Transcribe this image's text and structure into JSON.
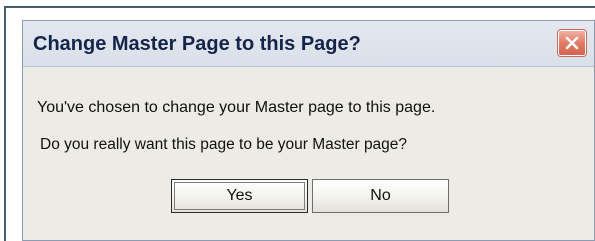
{
  "dialog": {
    "title": "Change Master Page to this Page?",
    "close_icon": "close-icon",
    "message_line1": "You've chosen to change your Master page to this page.",
    "message_line2": "Do you really want this page to be your Master page?",
    "yes_label": "Yes",
    "no_label": "No"
  },
  "colors": {
    "title_text": "#15244a",
    "dialog_background": "#ecebe6",
    "close_button": "#e07c68"
  }
}
